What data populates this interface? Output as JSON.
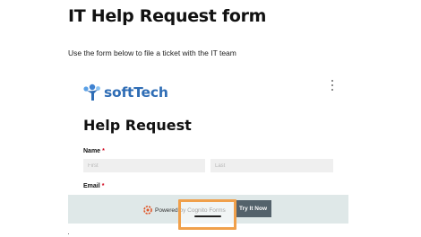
{
  "page": {
    "title": "IT Help Request form",
    "subtitle": "Use the form below to file a ticket with the IT team"
  },
  "form": {
    "logo_text": "softTech",
    "heading": "Help Request",
    "name_label": "Name",
    "required_marker": "*",
    "first_placeholder": "First",
    "last_placeholder": "Last",
    "email_label": "Email"
  },
  "banner": {
    "powered_text": "Powered by Cognito Forms",
    "try_button": "Try It Now"
  },
  "colors": {
    "logo_blue": "#2f6db5",
    "highlight_orange": "#f0a04b",
    "button_gray": "#54626b",
    "banner_bg": "#dfe8e8"
  },
  "icons": [
    "more-vertical-icon",
    "softtech-logo-icon",
    "cognito-logo-icon"
  ]
}
